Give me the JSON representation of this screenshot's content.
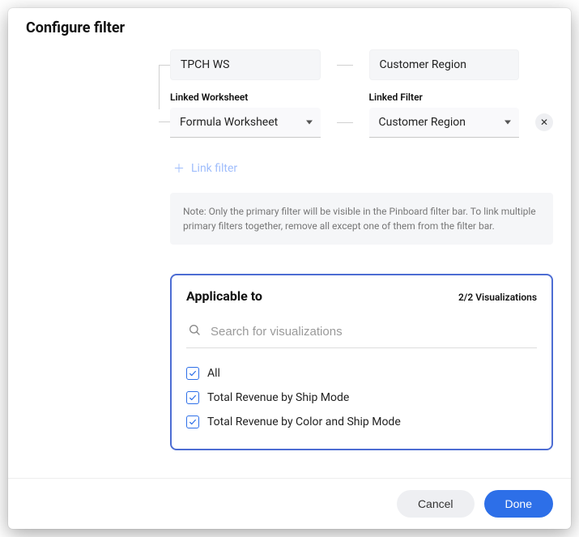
{
  "header": {
    "title": "Configure filter"
  },
  "linkSection": {
    "primary": {
      "worksheet": "TPCH WS",
      "filter": "Customer Region"
    },
    "linked": {
      "worksheetLabel": "Linked Worksheet",
      "worksheetValue": "Formula Worksheet",
      "filterLabel": "Linked Filter",
      "filterValue": "Customer Region"
    },
    "addLinkLabel": "Link filter",
    "note": "Note: Only the primary filter will be visible in the Pinboard filter bar. To link multiple primary filters together, remove all except one of them from the filter bar."
  },
  "applicable": {
    "title": "Applicable to",
    "count": "2/2 Visualizations",
    "searchPlaceholder": "Search for visualizations",
    "items": [
      {
        "label": "All",
        "checked": true
      },
      {
        "label": "Total Revenue by Ship Mode",
        "checked": true
      },
      {
        "label": "Total Revenue by Color and Ship Mode",
        "checked": true
      }
    ]
  },
  "footer": {
    "cancel": "Cancel",
    "done": "Done"
  }
}
